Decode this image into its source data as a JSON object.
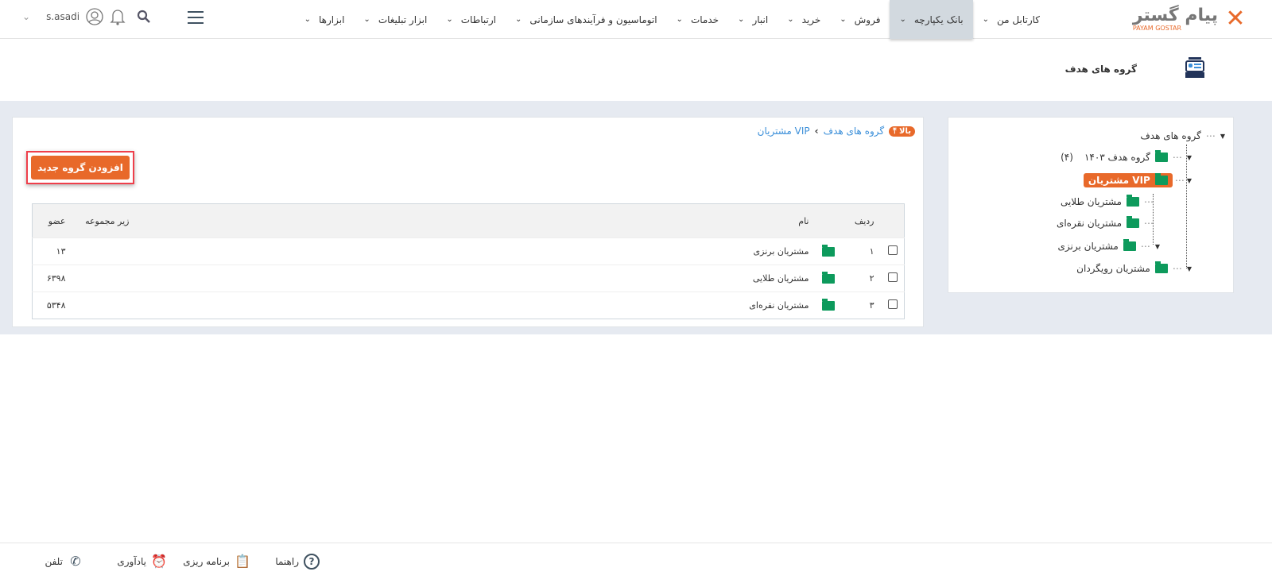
{
  "brand": {
    "name": "پیام گستر",
    "sub": "PAYAM GOSTAR"
  },
  "nav": [
    "کارتابل من",
    "بانک یکپارچه",
    "فروش",
    "خرید",
    "انبار",
    "خدمات",
    "اتوماسیون و فرآیندهای سازمانی",
    "ارتباطات",
    "ابزار تبلیغات",
    "ابزارها"
  ],
  "user": {
    "name": "s.asadi"
  },
  "page": {
    "title": "گروه های هدف"
  },
  "breadcrumb": {
    "up": "⤒ بالا",
    "root": "گروه های هدف",
    "current": "مشتریان VIP"
  },
  "add_button": "افزودن گروه جدید",
  "table": {
    "headers": {
      "row": "ردیف",
      "name": "نام",
      "sub": "زیر مجموعه",
      "members": "عضو"
    },
    "rows": [
      {
        "row": "۱",
        "name": "مشتریان برنزی",
        "members": "۱۳"
      },
      {
        "row": "۲",
        "name": "مشتریان طلایی",
        "members": "۶۳۹۸"
      },
      {
        "row": "۳",
        "name": "مشتریان نقره‌ای",
        "members": "۵۳۴۸"
      }
    ]
  },
  "tree": {
    "root": "گروه های هدف",
    "g1403": "گروه هدف ۱۴۰۳",
    "g1403_count": "(۴)",
    "vip": "مشتریان VIP",
    "gold": "مشتریان طلایی",
    "silver": "مشتریان نقره‌ای",
    "bronze": "مشتریان برنزی",
    "churn": "مشتریان رویگردان"
  },
  "footer": {
    "help": "راهنما",
    "planning": "برنامه ریزی",
    "reminder": "یادآوری",
    "phone": "تلفن"
  },
  "colors": {
    "accent": "#e8692a",
    "folder": "#0d9a5c",
    "link": "#3b8fd9"
  }
}
